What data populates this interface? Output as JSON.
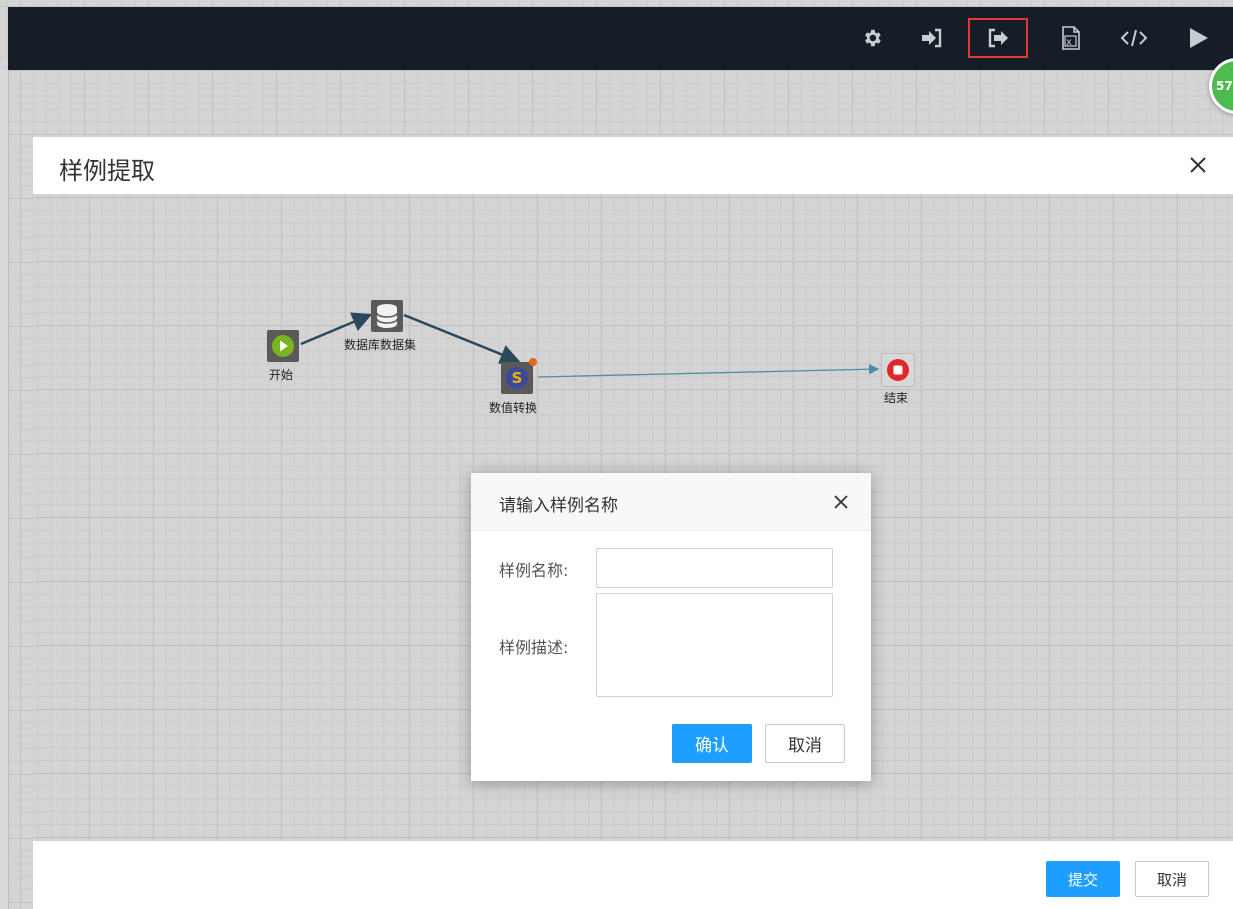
{
  "toolbar": {
    "icons": [
      "settings-icon",
      "import-icon",
      "export-icon",
      "excel-icon",
      "code-icon",
      "run-icon"
    ],
    "badge_text": "57"
  },
  "modal": {
    "title": "样例提取",
    "submit_label": "提交",
    "cancel_label": "取消"
  },
  "flow": {
    "nodes": [
      {
        "id": "start",
        "label": "开始",
        "icon": "play-icon"
      },
      {
        "id": "dataset",
        "label": "数据库数据集",
        "icon": "database-icon"
      },
      {
        "id": "transform",
        "label": "数值转换",
        "icon": "script-s-icon"
      },
      {
        "id": "end",
        "label": "结束",
        "icon": "stop-icon"
      }
    ]
  },
  "dialog": {
    "title": "请输入样例名称",
    "name_label": "样例名称:",
    "name_value": "",
    "desc_label": "样例描述:",
    "desc_value": "",
    "confirm_label": "确认",
    "cancel_label": "取消"
  },
  "colors": {
    "topbar": "#151e27",
    "primary": "#1e9fff",
    "badge": "#4dbb4f",
    "highlight": "#e33333"
  }
}
